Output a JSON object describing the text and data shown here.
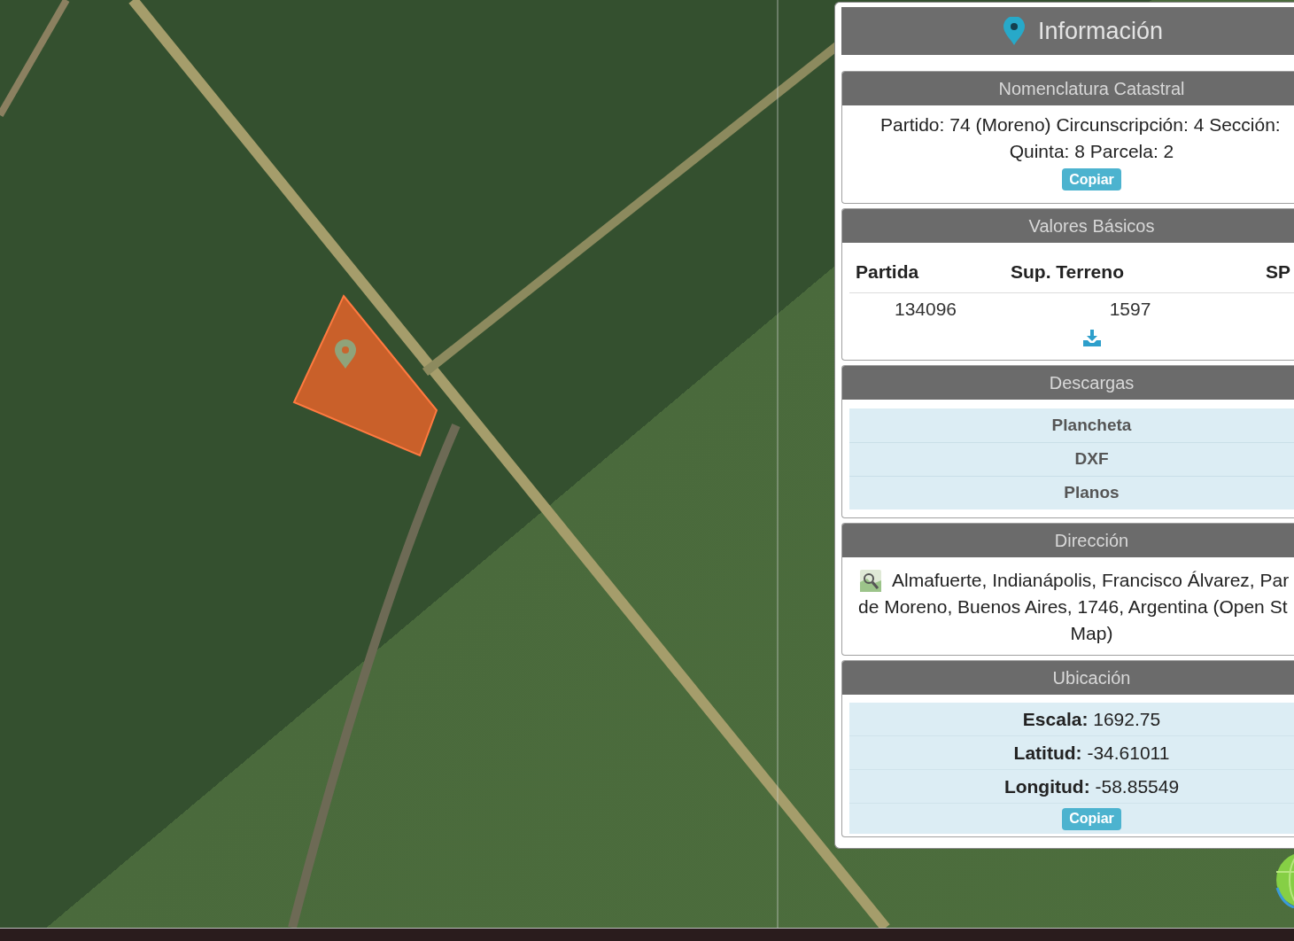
{
  "info_panel": {
    "title": "Información",
    "sections": [
      {
        "kind": "text",
        "title": "Nomenclatura Catastral",
        "lines": [
          "Partido: 74 (Moreno) Circunscripción: 4 Sección:",
          "Quinta: 8 Parcela: 2"
        ],
        "button": "Copiar"
      },
      {
        "kind": "table",
        "title": "Valores Básicos",
        "columns": [
          "Partida",
          "Sup. Terreno",
          "SP"
        ],
        "rows": [
          [
            "134096",
            "1597"
          ]
        ]
      },
      {
        "kind": "links",
        "title": "Descargas",
        "items": [
          "Plancheta",
          "DXF",
          "Planos"
        ]
      },
      {
        "kind": "address",
        "title": "Dirección",
        "lines": [
          "Almafuerte, Indianápolis, Francisco Álvarez, Par",
          "de Moreno, Buenos Aires, 1746, Argentina (Open St",
          "Map)"
        ]
      },
      {
        "kind": "fields",
        "title": "Ubicación",
        "fields": [
          "**Escala:** 1692.75",
          "**Latitud:** -34.61011",
          "**Longitud:** -58.85549"
        ],
        "button": "Copiar"
      }
    ]
  }
}
